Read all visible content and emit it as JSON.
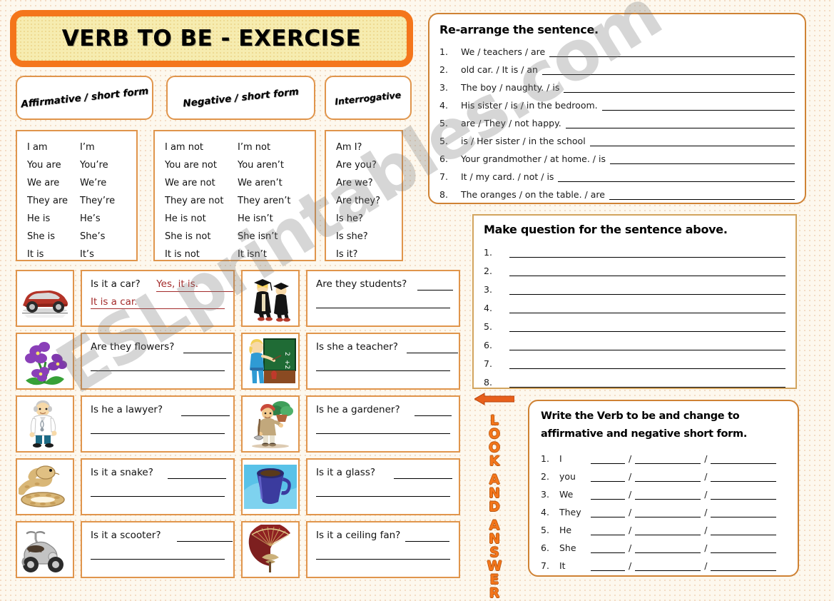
{
  "title": "VERB TO BE - EXERCISE",
  "watermark": "ESLprintables.com",
  "tabs": [
    {
      "label": "Affirmative / short form"
    },
    {
      "label": "Negative / short form"
    },
    {
      "label": "Interrogative"
    }
  ],
  "conjugation": {
    "affirmative": [
      {
        "long": "I am",
        "short": "I’m"
      },
      {
        "long": "You are",
        "short": "You’re"
      },
      {
        "long": "We are",
        "short": "We’re"
      },
      {
        "long": "They are",
        "short": "They’re"
      },
      {
        "long": "He is",
        "short": "He’s"
      },
      {
        "long": "She is",
        "short": "She’s"
      },
      {
        "long": "It is",
        "short": "It’s"
      }
    ],
    "negative": [
      {
        "long": "I am not",
        "short": "I’m not"
      },
      {
        "long": "You are not",
        "short": "You aren’t"
      },
      {
        "long": "We are not",
        "short": "We aren’t"
      },
      {
        "long": "They are not",
        "short": "They aren’t"
      },
      {
        "long": "He is not",
        "short": "He isn’t"
      },
      {
        "long": "She is not",
        "short": "She isn’t"
      },
      {
        "long": "It is not",
        "short": "It isn’t"
      }
    ],
    "interrogative": [
      {
        "long": "Am I?"
      },
      {
        "long": "Are you?"
      },
      {
        "long": "Are we?"
      },
      {
        "long": "Are they?"
      },
      {
        "long": "Is he?"
      },
      {
        "long": "Is she?"
      },
      {
        "long": "Is it?"
      }
    ]
  },
  "picture_exercises": [
    {
      "left": {
        "image": "red-sports-car-image",
        "question": "Is it a car?",
        "answer1": "Yes, it is.",
        "answer2": "It is a car.",
        "answered": true
      },
      "right": {
        "image": "two-graduates-image",
        "question": "Are they students?",
        "answered": false
      }
    },
    {
      "left": {
        "image": "purple-violet-flowers-image",
        "question": "Are they flowers?",
        "answered": false
      },
      "right": {
        "image": "teacher-at-blackboard-image",
        "question": "Is she a teacher?",
        "answered": false
      }
    },
    {
      "left": {
        "image": "man-in-white-coat-image",
        "question": "Is he a lawyer?",
        "answered": false
      },
      "right": {
        "image": "gardener-with-plant-image",
        "question": "Is he a gardener?",
        "answered": false
      }
    },
    {
      "left": {
        "image": "coiled-snake-image",
        "question": "Is it a snake?",
        "answered": false
      },
      "right": {
        "image": "blue-mug-image",
        "question": "Is it a glass?",
        "answered": false
      }
    },
    {
      "left": {
        "image": "grey-scooter-image",
        "question": "Is it a scooter?",
        "answered": false
      },
      "right": {
        "image": "red-folding-fan-image",
        "question": "Is it a ceiling fan?",
        "answered": false
      }
    }
  ],
  "rearrange": {
    "heading": "Re-arrange the sentence.",
    "items": [
      {
        "num": "1.",
        "text": "We / teachers / are"
      },
      {
        "num": "2.",
        "text": "old car. / It is / an"
      },
      {
        "num": "3.",
        "text": "The boy / naughty. / is"
      },
      {
        "num": "4.",
        "text": "His sister / is / in the bedroom."
      },
      {
        "num": "5.",
        "text": "are / They / not happy."
      },
      {
        "num": "5.",
        "text": "is / Her sister / in the school"
      },
      {
        "num": "6.",
        "text": "Your grandmother / at home. / is"
      },
      {
        "num": "7.",
        "text": "It / my card. / not / is"
      },
      {
        "num": "8.",
        "text": "The oranges / on the table. / are"
      }
    ]
  },
  "make_question": {
    "heading": "Make question for the sentence above.",
    "numbers": [
      "1.",
      "2.",
      "3.",
      "4.",
      "5.",
      "6.",
      "7.",
      "8."
    ]
  },
  "look_and_answer": {
    "arrow": "left-arrow-icon",
    "lines": [
      "LOOK",
      "AND",
      "ANSWER"
    ]
  },
  "write_verb": {
    "heading_line1": "Write the Verb to be and change to",
    "heading_line2": "affirmative and negative short form.",
    "items": [
      {
        "num": "1.",
        "pronoun": "I"
      },
      {
        "num": "2.",
        "pronoun": "you"
      },
      {
        "num": "3.",
        "pronoun": "We"
      },
      {
        "num": "4.",
        "pronoun": "They"
      },
      {
        "num": "5.",
        "pronoun": "He"
      },
      {
        "num": "6.",
        "pronoun": "She"
      },
      {
        "num": "7.",
        "pronoun": "It"
      }
    ],
    "separator": "/"
  },
  "colors": {
    "orange_accent": "#f4761b",
    "border_orange": "#cf8234",
    "border_light": "#e0954c",
    "title_fill": "#f6ecb0",
    "answer_red": "#a32b2b",
    "page_bg": "#fdf8ee"
  }
}
